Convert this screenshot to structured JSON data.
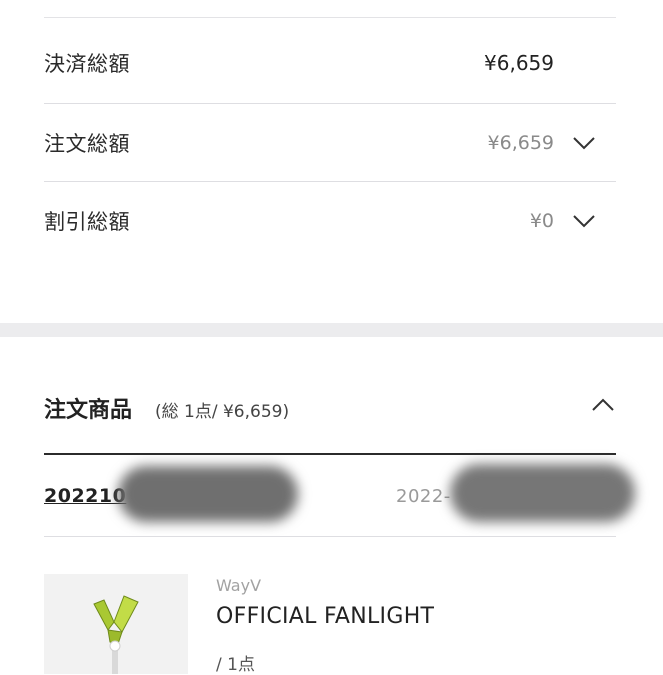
{
  "summary": {
    "payment_total_label": "決済総額",
    "payment_total_value": "¥6,659",
    "order_total_label": "注文総額",
    "order_total_value": "¥6,659",
    "discount_total_label": "割引総額",
    "discount_total_value": "¥0"
  },
  "order_items": {
    "title": "注文商品",
    "subtitle": "(総 1点/ ¥6,659)",
    "order_id": "202210",
    "order_date": "2022-",
    "item": {
      "brand": "WayV",
      "name": "OFFICIAL FANLIGHT",
      "quantity": "/ 1点"
    }
  },
  "icons": {
    "expand": "chevron-down-icon",
    "collapse": "chevron-up-icon"
  },
  "colors": {
    "divider": "#dedee2",
    "section_band": "#ececee",
    "muted_text": "#8a8a8a",
    "fanlight_green": "#b7d43a"
  }
}
